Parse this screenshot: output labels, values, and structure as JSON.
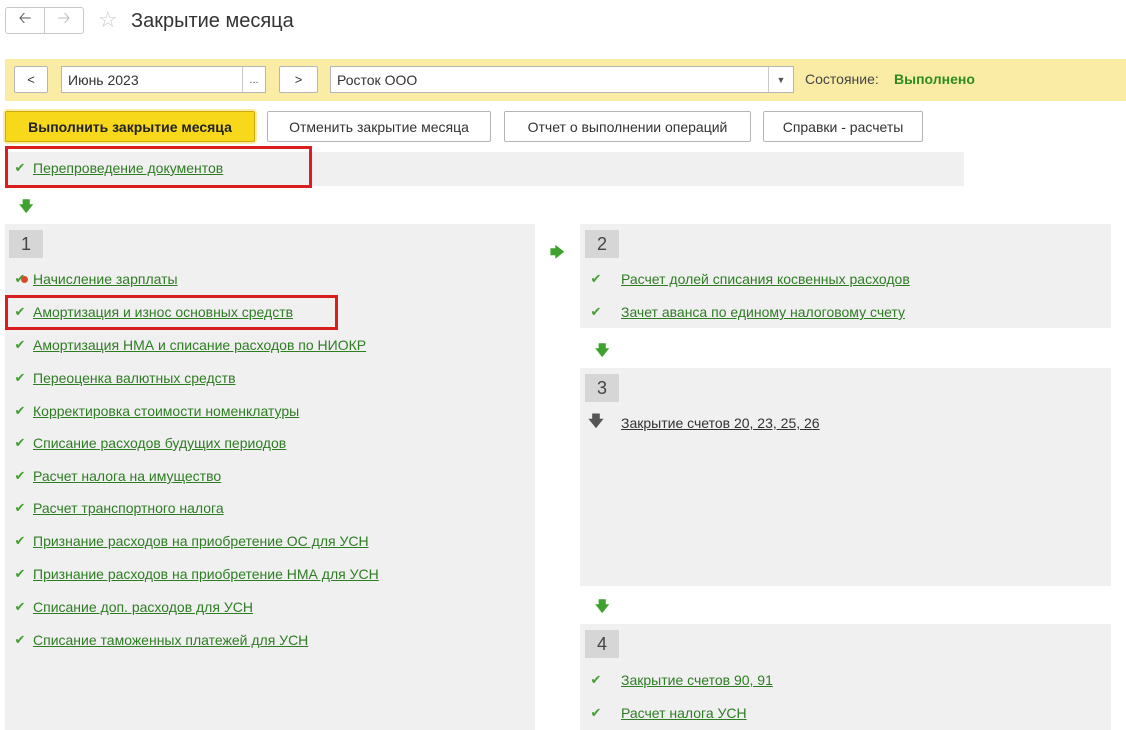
{
  "header": {
    "title": "Закрытие месяца"
  },
  "filter": {
    "prev_label": "<",
    "next_label": ">",
    "period": "Июнь 2023",
    "period_btn": "...",
    "organization": "Росток ООО",
    "state_label": "Состояние:",
    "state_value": "Выполнено"
  },
  "commands": {
    "run": "Выполнить закрытие месяца",
    "cancel": "Отменить закрытие месяца",
    "report": "Отчет о выполнении операций",
    "calc": "Справки - расчеты"
  },
  "pre_step": {
    "label": "Перепроведение документов"
  },
  "group1": {
    "number": "1",
    "items": [
      "Начисление зарплаты",
      "Амортизация и износ основных средств",
      "Амортизация НМА и списание расходов по НИОКР",
      "Переоценка валютных средств",
      "Корректировка стоимости номенклатуры",
      "Списание расходов будущих периодов",
      "Расчет налога на имущество",
      "Расчет транспортного налога",
      "Признание расходов на приобретение ОС для УСН",
      "Признание расходов на приобретение НМА для УСН",
      "Списание доп. расходов для УСН",
      "Списание таможенных платежей для УСН"
    ]
  },
  "group2": {
    "number": "2",
    "items": [
      "Расчет долей списания косвенных расходов",
      "Зачет аванса по единому налоговому счету"
    ]
  },
  "group3": {
    "number": "3",
    "items": [
      "Закрытие счетов 20, 23, 25, 26"
    ]
  },
  "group4": {
    "number": "4",
    "items": [
      "Закрытие счетов 90, 91",
      "Расчет налога УСН"
    ]
  },
  "colors": {
    "accent_green": "#2e7d23",
    "highlight": "#d81e1e",
    "bar_yellow": "#fbeca5",
    "primary_button": "#f7d81a"
  }
}
